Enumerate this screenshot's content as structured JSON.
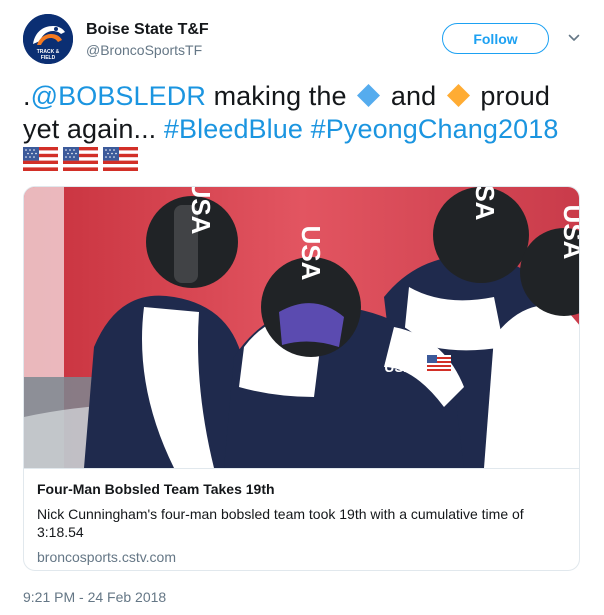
{
  "account": {
    "name": "Boise State T&F",
    "handle": "@BroncoSportsTF",
    "avatar_text": "TRACK & FIELD",
    "avatar_icon": "bronco-logo-icon"
  },
  "follow_button": {
    "label": "Follow"
  },
  "menu": {
    "icon": "chevron-down-icon"
  },
  "tweet": {
    "prefix": ".",
    "mention": "@BOBSLEDR",
    "text_1": " making the ",
    "text_2": " and ",
    "text_3": " proud yet again... ",
    "hashtag_1": "#BleedBlue",
    "hashtag_2": "#PyeongChang2018",
    "emoji_1": "large-blue-diamond-icon",
    "emoji_2": "large-orange-diamond-icon",
    "flags": [
      "us-flag-icon",
      "us-flag-icon",
      "us-flag-icon"
    ]
  },
  "card": {
    "image": {
      "helmet_text": "USA",
      "suit_text": "USA",
      "subject": "Four bobsledders in USA helmets pushing off"
    },
    "title": "Four-Man Bobsled Team Takes 19th",
    "description": "Nick Cunningham's four-man bobsled team took 19th with a cumulative time of 3:18.54",
    "domain": "broncosports.cstv.com"
  },
  "timestamp": "9:21 PM - 24 Feb 2018",
  "colors": {
    "link": "#1b95e0",
    "follow": "#1da1f2",
    "muted": "#657786",
    "brand_blue": "#0b2f73",
    "brand_orange": "#f47a20"
  }
}
